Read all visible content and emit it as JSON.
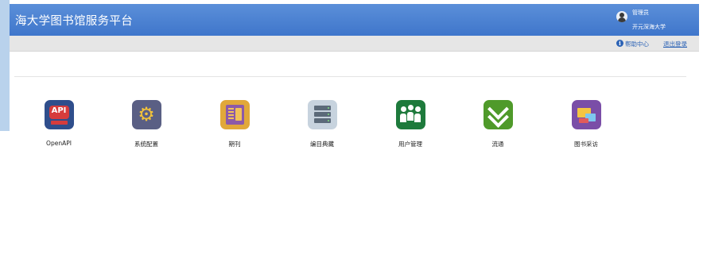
{
  "header": {
    "title": "海大学图书馆服务平台",
    "user_role": "管理员",
    "user_org": "开元深海大学"
  },
  "subbar": {
    "help_label": "帮助中心",
    "logout_label": "退出登录"
  },
  "modules": [
    {
      "label": "OpenAPI",
      "icon": "api-icon",
      "icon_text": "API",
      "color": "#2f4e8c"
    },
    {
      "label": "系统配置",
      "icon": "gear-icon",
      "color": "#5a5f84"
    },
    {
      "label": "期刊",
      "icon": "journal-icon",
      "color": "#e1a83a"
    },
    {
      "label": "编目典藏",
      "icon": "server-icon",
      "color": "#c7d3de"
    },
    {
      "label": "用户管理",
      "icon": "users-icon",
      "color": "#1e7a3c"
    },
    {
      "label": "流通",
      "icon": "chevron-down-icon",
      "color": "#4f9a2a"
    },
    {
      "label": "图书采访",
      "icon": "books-icon",
      "color": "#7a4ea7"
    }
  ]
}
